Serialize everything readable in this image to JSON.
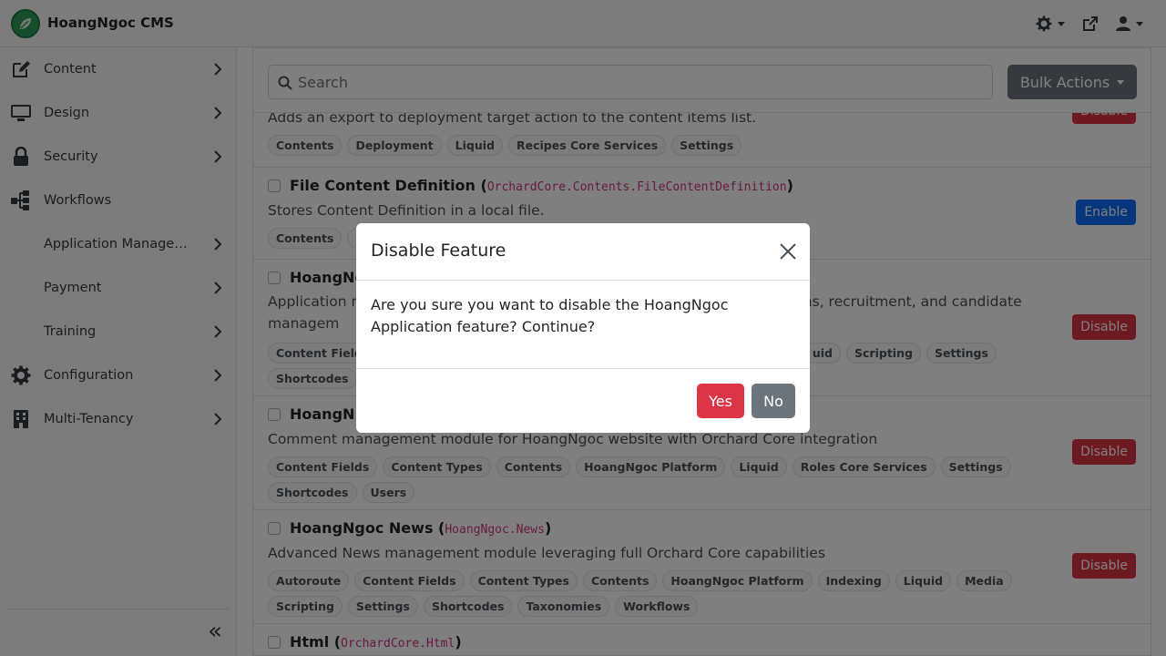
{
  "app": {
    "brand": "HoangNgoc CMS"
  },
  "sidebar": {
    "items": [
      {
        "label": "Content",
        "icon": "edit-icon"
      },
      {
        "label": "Design",
        "icon": "monitor-icon"
      },
      {
        "label": "Security",
        "icon": "lock-icon"
      },
      {
        "label": "Workflows",
        "icon": "workflow-icon"
      },
      {
        "label": "Application Management",
        "icon": ""
      },
      {
        "label": "Payment",
        "icon": ""
      },
      {
        "label": "Training",
        "icon": ""
      },
      {
        "label": "Configuration",
        "icon": "gear-icon"
      },
      {
        "label": "Multi-Tenancy",
        "icon": "building-icon"
      }
    ],
    "collapse": "«"
  },
  "search": {
    "placeholder": "Search"
  },
  "bulk_actions": {
    "label": "Bulk Actions"
  },
  "features": [
    {
      "title": "",
      "code": "",
      "description": "Adds an export to deployment target action to the content items list.",
      "tags": [
        "Contents",
        "Deployment",
        "Liquid",
        "Recipes Core Services",
        "Settings"
      ],
      "action": "Disable"
    },
    {
      "title": "File Content Definition",
      "code": "OrchardCore.Contents.FileContentDefinition",
      "description": "Stores Content Definition in a local file.",
      "tags": [
        "Contents",
        "L"
      ],
      "action": "Enable"
    },
    {
      "title": "HoangNg",
      "code": "",
      "description": "Application m",
      "description_right": "ions, recruitment, and candidate",
      "description_line2": "managem",
      "tags": [
        "Content Field",
        "uid",
        "Scripting",
        "Settings",
        "Shortcodes"
      ],
      "action": "Disable"
    },
    {
      "title": "HoangN",
      "code": "",
      "description": "Comment management module for HoangNgoc website with Orchard Core integration",
      "tags": [
        "Content Fields",
        "Content Types",
        "Contents",
        "HoangNgoc Platform",
        "Liquid",
        "Roles Core Services",
        "Settings",
        "Shortcodes",
        "Users"
      ],
      "action": "Disable"
    },
    {
      "title": "HoangNgoc News",
      "code": "HoangNgoc.News",
      "description": "Advanced News management module leveraging full Orchard Core capabilities",
      "tags": [
        "Autoroute",
        "Content Fields",
        "Content Types",
        "Contents",
        "HoangNgoc Platform",
        "Indexing",
        "Liquid",
        "Media",
        "Scripting",
        "Settings",
        "Shortcodes",
        "Taxonomies",
        "Workflows"
      ],
      "action": "Disable"
    },
    {
      "title": "Html",
      "code": "OrchardCore.Html",
      "description": "",
      "tags": [],
      "action": ""
    }
  ],
  "modal": {
    "title": "Disable Feature",
    "body": "Are you sure you want to disable the HoangNgoc Application feature? Continue?",
    "yes": "Yes",
    "no": "No"
  },
  "colors": {
    "danger": "#dc3545",
    "primary": "#0d6efd",
    "secondary": "#6c757d",
    "brand": "#2f9e5a",
    "code": "#d63384"
  }
}
